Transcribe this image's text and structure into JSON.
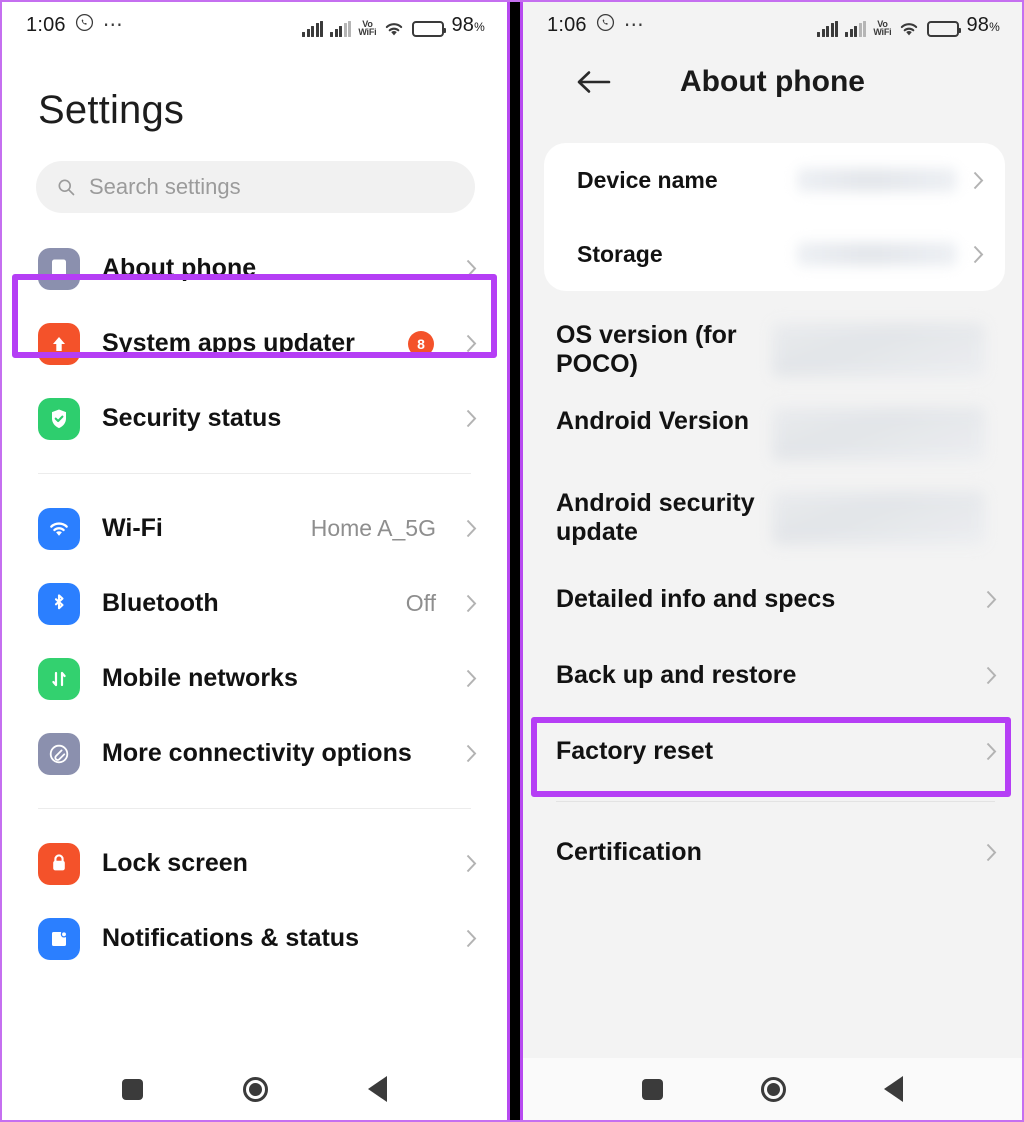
{
  "status_bar": {
    "time": "1:06",
    "whatsapp_icon": "whatsapp-icon",
    "overflow_dots": "⋯",
    "volte_top": "Vo",
    "volte_bottom": "WiFi",
    "battery_percent": "98",
    "percent_symbol": "%"
  },
  "left_phone": {
    "page_title": "Settings",
    "search": {
      "placeholder": "Search settings",
      "value": ""
    },
    "highlight_color": "#b53ef5",
    "items": [
      {
        "label": "About phone",
        "value": "",
        "badge": "",
        "icon": "phone-icon",
        "tile": "tile-grayblue",
        "highlighted": true
      },
      {
        "label": "System apps updater",
        "value": "",
        "badge": "8",
        "icon": "arrow-up-icon",
        "tile": "tile-orange",
        "highlighted": false
      },
      {
        "label": "Security status",
        "value": "",
        "badge": "",
        "icon": "shield-check-icon",
        "tile": "tile-green",
        "highlighted": false
      },
      {
        "label": "Wi-Fi",
        "value": "Home A_5G",
        "badge": "",
        "icon": "wifi-icon",
        "tile": "tile-blue",
        "highlighted": false
      },
      {
        "label": "Bluetooth",
        "value": "Off",
        "badge": "",
        "icon": "bluetooth-icon",
        "tile": "tile-blue",
        "highlighted": false
      },
      {
        "label": "Mobile networks",
        "value": "",
        "badge": "",
        "icon": "data-transfer-icon",
        "tile": "tile-mgreen",
        "highlighted": false
      },
      {
        "label": "More connectivity options",
        "value": "",
        "badge": "",
        "icon": "link-icon",
        "tile": "tile-grayblue",
        "highlighted": false
      },
      {
        "label": "Lock screen",
        "value": "",
        "badge": "",
        "icon": "lock-icon",
        "tile": "tile-orange",
        "highlighted": false
      },
      {
        "label": "Notifications & status",
        "value": "",
        "badge": "",
        "icon": "notification-icon",
        "tile": "tile-blue",
        "highlighted": false
      }
    ]
  },
  "right_phone": {
    "appbar": {
      "back_icon": "back-arrow-icon",
      "title": "About phone"
    },
    "card_rows": [
      {
        "label": "Device name",
        "value": ""
      },
      {
        "label": "Storage",
        "value": ""
      }
    ],
    "info_rows": [
      {
        "label": "OS version (for POCO)",
        "value": ""
      },
      {
        "label": "Android Version",
        "value": ""
      },
      {
        "label": "Android security update",
        "value": ""
      }
    ],
    "link_rows": [
      {
        "label": "Detailed info and specs",
        "highlighted": true
      },
      {
        "label": "Back up and restore",
        "highlighted": false
      },
      {
        "label": "Factory reset",
        "highlighted": false
      },
      {
        "label": "Certification",
        "highlighted": false
      }
    ],
    "highlight_color": "#b53ef5"
  },
  "nav_bar": {
    "recents": "recents-square-icon",
    "home": "home-circle-icon",
    "back": "back-triangle-icon"
  }
}
